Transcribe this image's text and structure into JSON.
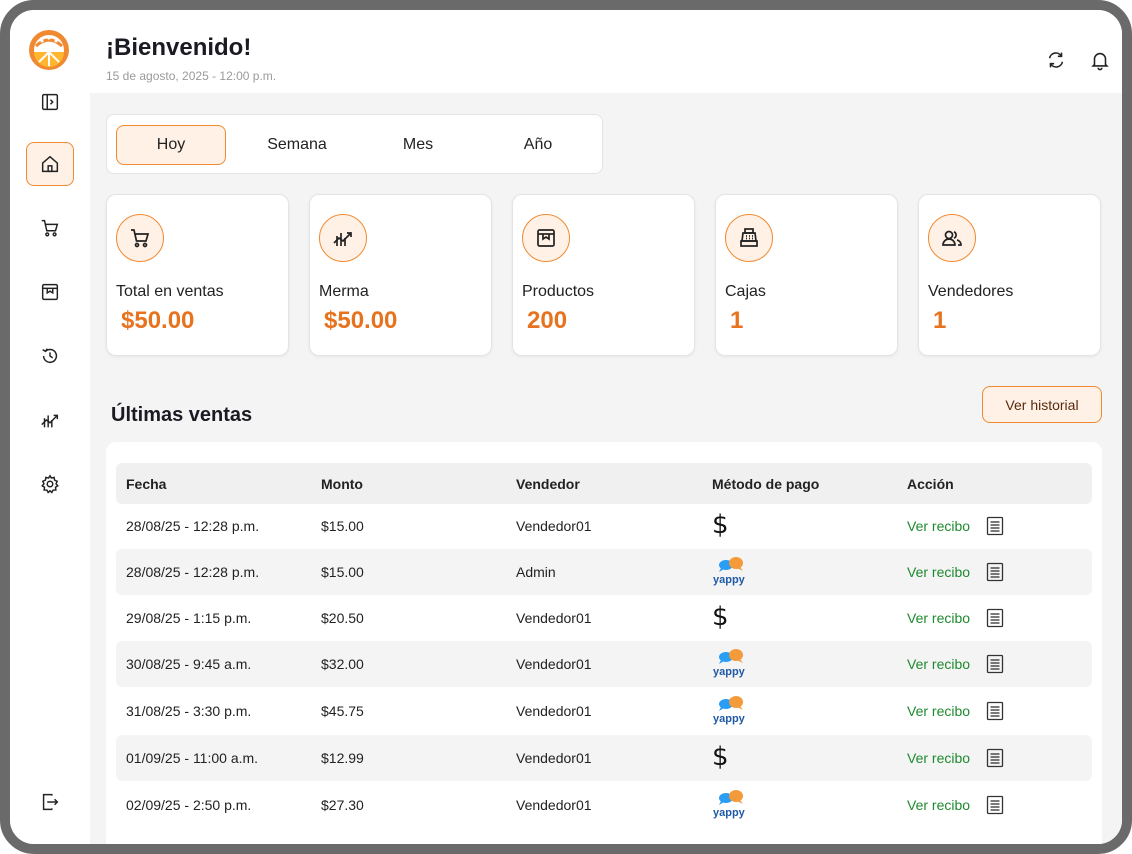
{
  "app": {
    "title": "¡Bienvenido!",
    "date": "15 de agosto, 2025 - 12:00 p.m."
  },
  "sidebar": {
    "items": [
      {
        "name": "sidebar-toggle",
        "icon": "sidebar-toggle-icon"
      },
      {
        "name": "home",
        "icon": "home-icon",
        "active": true
      },
      {
        "name": "cart",
        "icon": "cart-icon"
      },
      {
        "name": "products",
        "icon": "box-icon"
      },
      {
        "name": "history",
        "icon": "history-icon"
      },
      {
        "name": "analytics",
        "icon": "chart-icon"
      },
      {
        "name": "settings",
        "icon": "gear-icon"
      },
      {
        "name": "logout",
        "icon": "logout-icon"
      }
    ]
  },
  "tabs": [
    {
      "label": "Hoy",
      "active": true
    },
    {
      "label": "Semana"
    },
    {
      "label": "Mes"
    },
    {
      "label": "Año"
    }
  ],
  "cards": [
    {
      "label": "Total en ventas",
      "value": "$50.00",
      "icon": "cart-icon"
    },
    {
      "label": "Merma",
      "value": "$50.00",
      "icon": "chart-icon"
    },
    {
      "label": "Productos",
      "value": "200",
      "icon": "box-icon"
    },
    {
      "label": "Cajas",
      "value": "1",
      "icon": "cash-register-icon"
    },
    {
      "label": "Vendedores",
      "value": "1",
      "icon": "users-icon"
    }
  ],
  "sales": {
    "title": "Últimas ventas",
    "history_button": "Ver historial",
    "columns": [
      "Fecha",
      "Monto",
      "Vendedor",
      "Método de pago",
      "Acción"
    ],
    "action_label": "Ver recibo",
    "yappy_label": "yappy",
    "cash_symbol": "$",
    "rows": [
      {
        "date": "28/08/25 - 12:28 p.m.",
        "amount": "$15.00",
        "seller": "Vendedor01",
        "method": "cash"
      },
      {
        "date": "28/08/25 - 12:28 p.m.",
        "amount": "$15.00",
        "seller": "Admin",
        "method": "yappy"
      },
      {
        "date": "29/08/25 - 1:15 p.m.",
        "amount": "$20.50",
        "seller": "Vendedor01",
        "method": "cash"
      },
      {
        "date": "30/08/25 - 9:45 a.m.",
        "amount": "$32.00",
        "seller": "Vendedor01",
        "method": "yappy"
      },
      {
        "date": "31/08/25 - 3:30 p.m.",
        "amount": "$45.75",
        "seller": "Vendedor01",
        "method": "yappy"
      },
      {
        "date": "01/09/25 - 11:00 a.m.",
        "amount": "$12.99",
        "seller": "Vendedor01",
        "method": "cash"
      },
      {
        "date": "02/09/25 - 2:50 p.m.",
        "amount": "$27.30",
        "seller": "Vendedor01",
        "method": "yappy"
      }
    ]
  },
  "colors": {
    "accent": "#f08a32",
    "accent_bg": "#fff1e6",
    "value": "#e8731f",
    "link": "#1e8a2e"
  }
}
